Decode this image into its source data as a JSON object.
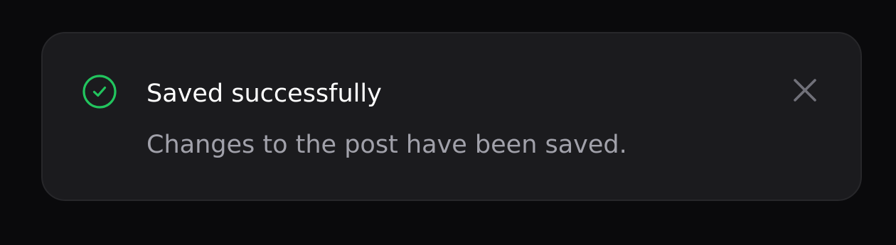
{
  "toast": {
    "status": "success",
    "icon": "check-circle-icon",
    "title": "Saved successfully",
    "description": "Changes to the post have been saved.",
    "close_icon": "close-icon"
  },
  "colors": {
    "page_background": "#0a0a0c",
    "toast_background": "#1b1b1e",
    "toast_border": "#27272a",
    "success": "#22c55e",
    "title_text": "#ffffff",
    "description_text": "#a1a1aa",
    "close_icon": "#71717a"
  }
}
